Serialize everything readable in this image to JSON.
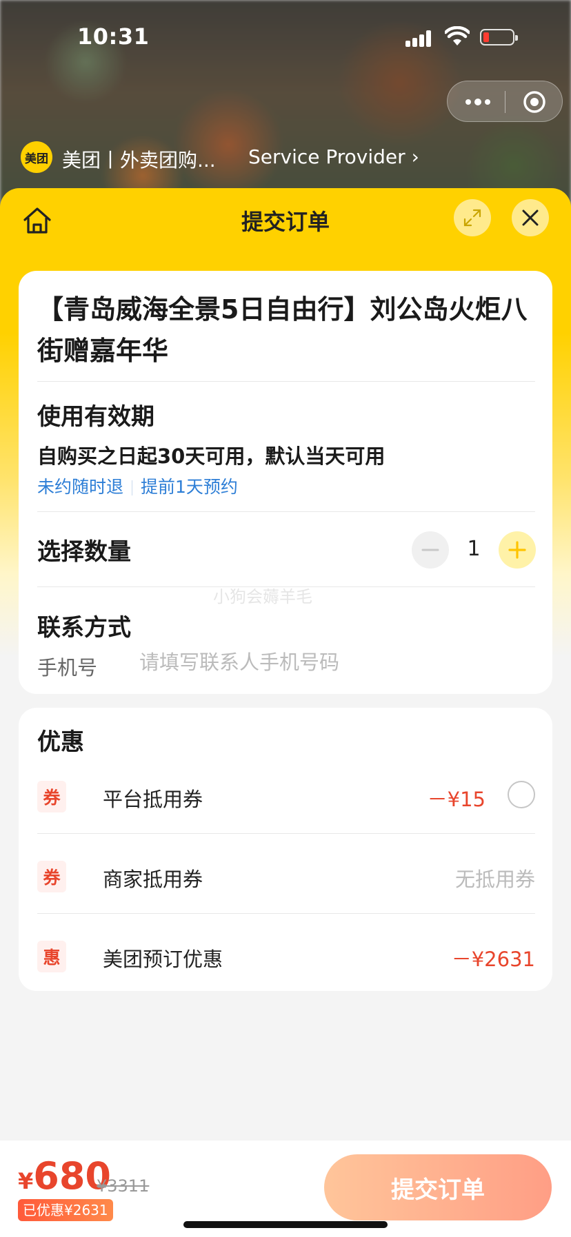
{
  "status_bar": {
    "time": "10:31"
  },
  "header": {
    "provider_logo": "美团",
    "provider_name": "美团丨外卖团购...",
    "provider_link": "Service Provider ›"
  },
  "sheet": {
    "title": "提交订单"
  },
  "product": {
    "title": "【青岛威海全景5日自由行】刘公岛火炬八街赠嘉年华",
    "validity_label": "使用有效期",
    "validity_text": "自购买之日起30天可用，默认当天可用",
    "tags": [
      "未约随时退",
      "提前1天预约"
    ]
  },
  "quantity": {
    "label": "选择数量",
    "value": "1"
  },
  "watermark": "小狗会薅羊毛",
  "contact": {
    "label": "联系方式",
    "phone_label": "手机号",
    "phone_placeholder": "请填写联系人手机号码",
    "phone_value": ""
  },
  "discounts": {
    "title": "优惠",
    "items": [
      {
        "badge": "券",
        "name": "平台抵用券",
        "value": "－¥15",
        "selectable": true
      },
      {
        "badge": "券",
        "name": "商家抵用券",
        "value": "无抵用券",
        "muted": true
      },
      {
        "badge": "惠",
        "name": "美团预订优惠",
        "value": "－¥2631"
      }
    ]
  },
  "footer": {
    "currency": "¥",
    "price": "680",
    "original_price": "¥3311",
    "saved": "已优惠¥2631",
    "submit_label": "提交订单"
  },
  "colors": {
    "brand_yellow": "#ffd100",
    "price_red": "#e8452c",
    "link_blue": "#2d7ed6"
  }
}
